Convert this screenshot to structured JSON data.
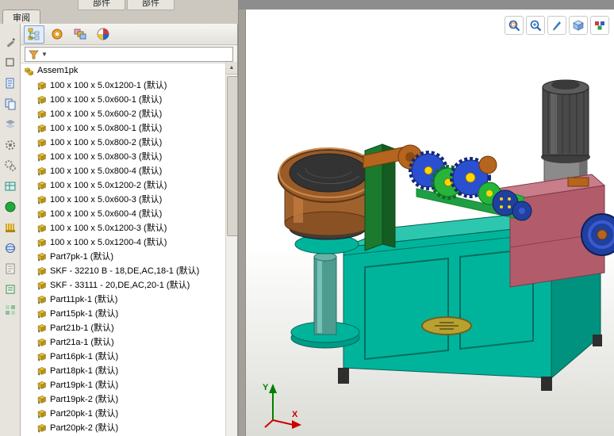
{
  "titlebar": {
    "review_tab": "审阅",
    "toolbar_buttons": [
      {
        "label": "部件"
      },
      {
        "label": "部件"
      }
    ]
  },
  "panel": {
    "tab_icons": [
      "featuremanager-tree-icon",
      "propertymanager-icon",
      "configurationmanager-icon",
      "displaymanager-icon"
    ],
    "filter": {
      "funnel_icon": "filter-funnel-icon",
      "dropdown_glyph": "▼"
    },
    "scroll_up_glyph": "▲"
  },
  "left_toolbar": {
    "icons": [
      "pencil-icon",
      "shapes-icon",
      "document-icon",
      "copy-icon",
      "layers-icon",
      "gear-icon",
      "gears-icon",
      "table-icon",
      "record-icon",
      "brush-icon",
      "sphere-icon",
      "note-icon",
      "memo-icon",
      "grid-icon"
    ]
  },
  "tree": {
    "root": "Assem1pk",
    "items": [
      "100 x 100 x 5.0x1200-1 (默认)",
      "100 x 100 x 5.0x600-1 (默认)",
      "100 x 100 x 5.0x600-2 (默认)",
      "100 x 100 x 5.0x800-1 (默认)",
      "100 x 100 x 5.0x800-2 (默认)",
      "100 x 100 x 5.0x800-3 (默认)",
      "100 x 100 x 5.0x800-4 (默认)",
      "100 x 100 x 5.0x1200-2 (默认)",
      "100 x 100 x 5.0x600-3 (默认)",
      "100 x 100 x 5.0x600-4 (默认)",
      "100 x 100 x 5.0x1200-3 (默认)",
      "100 x 100 x 5.0x1200-4 (默认)",
      "Part7pk-1 (默认)",
      "SKF - 32210 B - 18,DE,AC,18-1 (默认)",
      "SKF - 33111 - 20,DE,AC,20-1 (默认)",
      "Part11pk-1 (默认)",
      "Part15pk-1 (默认)",
      "Part21b-1 (默认)",
      "Part21a-1 (默认)",
      "Part16pk-1 (默认)",
      "Part18pk-1 (默认)",
      "Part19pk-1 (默认)",
      "Part19pk-2 (默认)",
      "Part20pk-1 (默认)",
      "Part20pk-2 (默认)"
    ]
  },
  "viewport": {
    "view_tools": [
      "zoom-to-area",
      "zoom-to-fit",
      "view-settings",
      "view-orientation",
      "display-style"
    ],
    "triad": {
      "x_label": "X",
      "y_label": "Y"
    }
  },
  "colors": {
    "machine_teal": "#00b49c",
    "bowl_brown": "#9a5b28",
    "motor_gray": "#4a4a4a",
    "gearbox_pink": "#b25c6b",
    "bracket_green": "#1c7a2e",
    "gear_blue": "#2a4fd0",
    "gear_green": "#27b539",
    "copper": "#b5651d",
    "pulley_blue": "#20409f",
    "nameplate_gold": "#b8a12f"
  }
}
